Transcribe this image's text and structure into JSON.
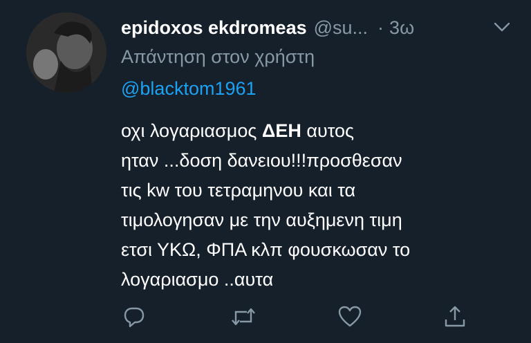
{
  "tweet": {
    "display_name": "epidoxos ekdromeas",
    "handle": "@su...",
    "separator": "·",
    "time": "3ω",
    "reply_prefix": "Απάντηση στον χρήστη",
    "reply_mention": "@blacktom1961",
    "body": {
      "line1_start": "οχι λογαριασμος ",
      "line1_bold": "ΔΕΗ",
      "line1_end": " αυτος",
      "line2": "ηταν ...δοση δανειου!!!προσθεσαν",
      "line3": "τις kw  του τετραμηνου και τα",
      "line4": "τιμολογησαν με την αυξημενη τιμη",
      "line5": "ετσι ΥΚΩ, ΦΠΑ κλπ φουσκωσαν το",
      "line6": "λογαριασμο ..αυτα"
    }
  },
  "icons": {
    "caret": "chevron-down-icon",
    "reply": "reply-icon",
    "retweet": "retweet-icon",
    "like": "heart-icon",
    "share": "share-icon"
  },
  "colors": {
    "background": "#15202b",
    "secondary_text": "#8899a6",
    "link": "#1da1f2",
    "primary_text": "#ffffff"
  }
}
